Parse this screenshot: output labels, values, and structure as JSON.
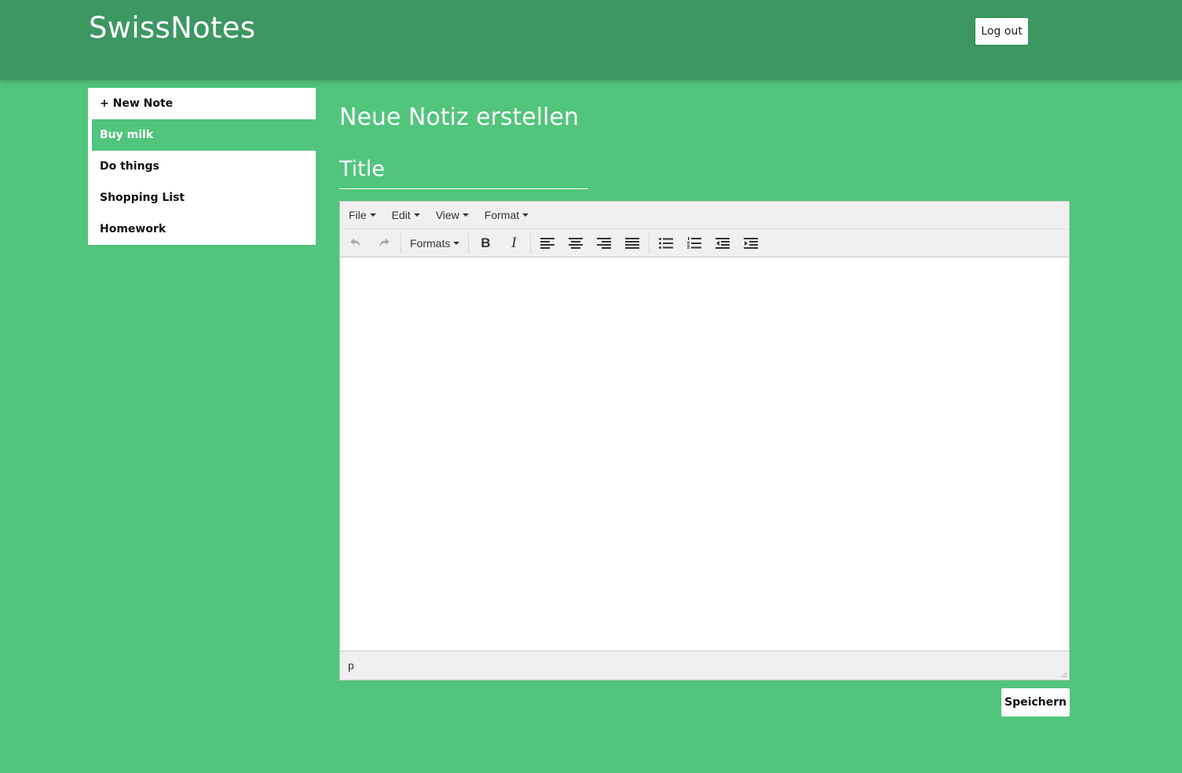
{
  "app": {
    "title": "SwissNotes",
    "logout_label": "Log out"
  },
  "sidebar": {
    "items": [
      {
        "label": "+ New Note",
        "active": false
      },
      {
        "label": "Buy milk",
        "active": true
      },
      {
        "label": "Do things",
        "active": false
      },
      {
        "label": "Shopping List",
        "active": false
      },
      {
        "label": "Homework",
        "active": false
      }
    ]
  },
  "main": {
    "page_title": "Neue Notiz erstellen",
    "title_placeholder": "Title",
    "title_value": "",
    "save_label": "Speichern"
  },
  "editor": {
    "menus": [
      "File",
      "Edit",
      "View",
      "Format"
    ],
    "formats_label": "Formats",
    "status_path": "p",
    "content": ""
  },
  "colors": {
    "background": "#51c57b",
    "header": "#3c9761",
    "toolbar": "#f0f0f0",
    "icon": "#333333"
  }
}
